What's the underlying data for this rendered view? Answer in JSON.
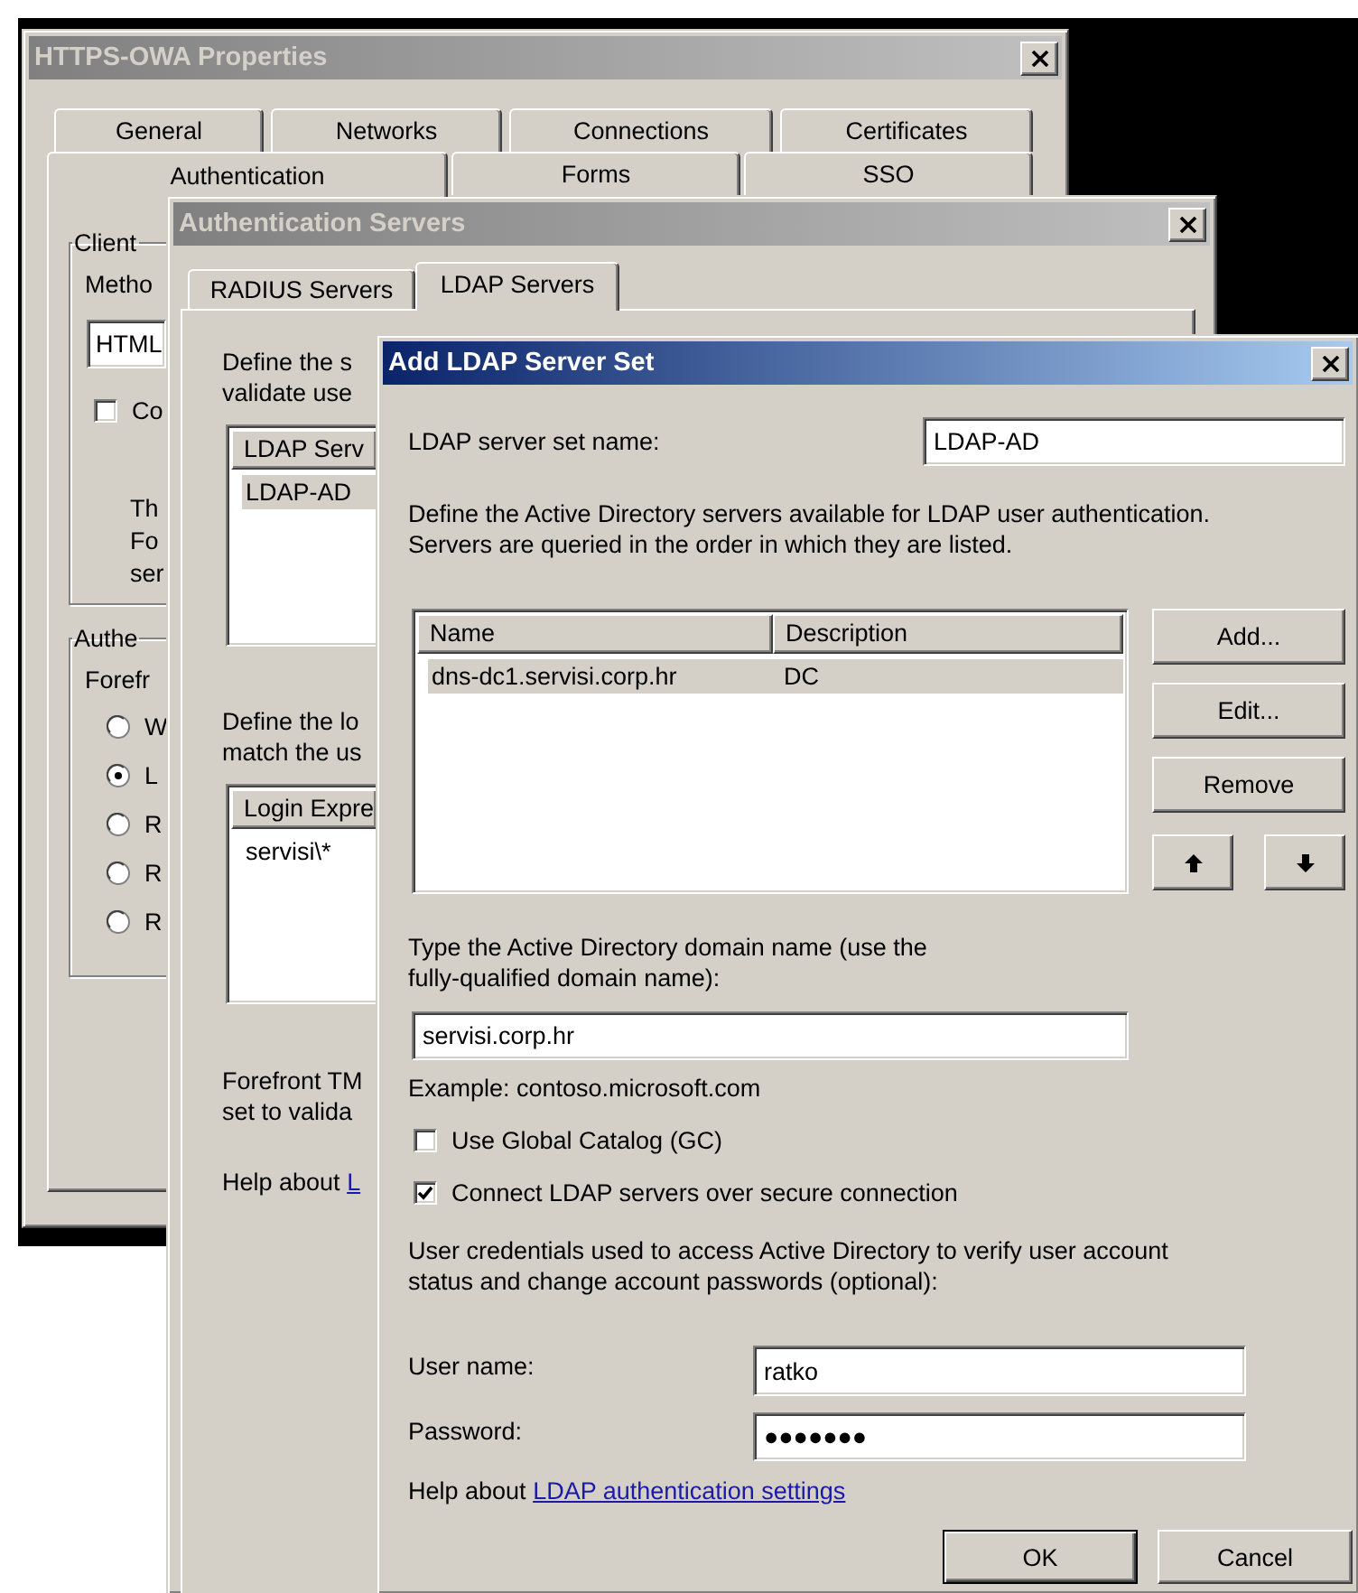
{
  "properties_window": {
    "title": "HTTPS-OWA Properties",
    "active": false,
    "tab_rows": [
      [
        {
          "label": "General",
          "selected": false
        },
        {
          "label": "Networks",
          "selected": false
        },
        {
          "label": "Connections",
          "selected": false
        },
        {
          "label": "Certificates",
          "selected": false
        }
      ],
      [
        {
          "label": "Authentication",
          "selected": true
        },
        {
          "label": "Forms",
          "selected": false
        },
        {
          "label": "SSO",
          "selected": false
        }
      ]
    ],
    "client_group": {
      "title": "Client",
      "method_label": "Metho",
      "method_value": "HTML",
      "checkbox": {
        "label": "Co",
        "checked": false
      },
      "note": "Th\nFo\nser"
    },
    "auth_group": {
      "title": "Authe",
      "caption": "Forefr",
      "options": [
        {
          "label": "W",
          "selected": false
        },
        {
          "label": "L",
          "selected": true
        },
        {
          "label": "R",
          "selected": false
        },
        {
          "label": "R",
          "selected": false
        },
        {
          "label": "R",
          "selected": false
        }
      ]
    }
  },
  "servers_window": {
    "title": "Authentication Servers",
    "active": false,
    "tabs": [
      {
        "label": "RADIUS Servers",
        "selected": false
      },
      {
        "label": "LDAP Servers",
        "selected": true
      }
    ],
    "intro": "Define the s\nvalidate use",
    "server_sets": {
      "columns": [
        "LDAP Serv"
      ],
      "rows": [
        {
          "cells": [
            "LDAP-AD"
          ],
          "selected": true
        }
      ]
    },
    "login_intro": "Define the lo\nmatch the us",
    "login_expressions": {
      "columns": [
        "Login Expre"
      ],
      "rows": [
        {
          "cells": [
            "servisi\\*"
          ],
          "selected": false
        }
      ]
    },
    "note": "Forefront TM\nset to valida",
    "help": {
      "text": "Help about",
      "link": "L"
    }
  },
  "ldap_dialog": {
    "title": "Add LDAP Server Set",
    "active": true,
    "name_label": "LDAP server set name:",
    "name_value": "LDAP-AD",
    "description": "Define the Active Directory servers available for LDAP user authentication.\nServers are queried in the order in which they are listed.",
    "servers": {
      "columns": [
        "Name",
        "Description"
      ],
      "rows": [
        {
          "cells": [
            "dns-dc1.servisi.corp.hr",
            "DC"
          ],
          "selected": true
        }
      ]
    },
    "list_buttons": [
      "Add...",
      "Edit...",
      "Remove"
    ],
    "move_buttons": [
      {
        "kind": "up"
      },
      {
        "kind": "down"
      }
    ],
    "domain_label": "Type the Active Directory domain name (use the\nfully-qualified domain name):",
    "domain_value": "servisi.corp.hr",
    "example": "Example: contoso.microsoft.com",
    "options": [
      {
        "label": "Use Global Catalog (GC)",
        "checked": false
      },
      {
        "label": "Connect LDAP servers over secure connection",
        "checked": true
      }
    ],
    "credentials_note": "User credentials used to access Active Directory to verify user account\nstatus and change account passwords (optional):",
    "user_name": {
      "label": "User name:",
      "value": "ratko"
    },
    "password": {
      "label": "Password:",
      "value": "●●●●●●●"
    },
    "help": {
      "text": "Help about",
      "link": "LDAP authentication settings"
    },
    "buttons": [
      {
        "label": "OK",
        "default": true
      },
      {
        "label": "Cancel",
        "default": false
      }
    ]
  }
}
